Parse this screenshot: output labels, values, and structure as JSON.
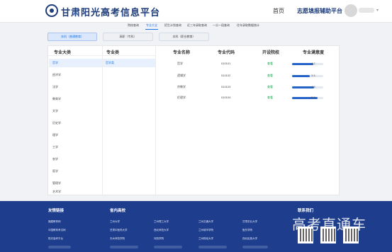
{
  "header": {
    "logo_text": "甘肃阳光高考信息平台",
    "nav_home": "首页",
    "nav_platform": "志愿填报辅助平台"
  },
  "colors": {
    "brand": "#1f3d7a",
    "accent": "#1a73e8",
    "footer_bg": "#1e3d8c",
    "bar": "#2563c9",
    "link_green": "#16a34a"
  },
  "subnav": {
    "items": [
      {
        "label": "院校查询"
      },
      {
        "label": "专业大全"
      },
      {
        "label": "招生计划查询"
      },
      {
        "label": "近三年录取查询"
      },
      {
        "label": "一分一段查询"
      },
      {
        "label": "往年录取数据统计"
      }
    ]
  },
  "levels": {
    "items": [
      {
        "label": "本科（普通教育）"
      },
      {
        "label": "高职（专科）"
      },
      {
        "label": "本科（职业教育）"
      }
    ]
  },
  "table": {
    "headers": {
      "category": "专业大类",
      "subcategory": "专业类",
      "name": "专业名称",
      "code": "专业代码",
      "schools": "开设院校",
      "satisfaction": "专业满意度"
    },
    "categories": [
      {
        "label": "哲学"
      },
      {
        "label": "经济学"
      },
      {
        "label": "法学"
      },
      {
        "label": "教育学"
      },
      {
        "label": "文学"
      },
      {
        "label": "历史学"
      },
      {
        "label": "理学"
      },
      {
        "label": "工学"
      },
      {
        "label": "农学"
      },
      {
        "label": "医学"
      },
      {
        "label": "管理学"
      },
      {
        "label": "艺术学"
      }
    ],
    "subcategory": "哲学类",
    "rows": [
      {
        "name": "哲学",
        "code": "010101",
        "link": "查看",
        "score_label": "4.2",
        "score": 4.2
      },
      {
        "name": "逻辑学",
        "code": "010102",
        "link": "查看",
        "score_label": "3.5",
        "score": 3.5
      },
      {
        "name": "宗教学",
        "code": "010103",
        "link": "查看",
        "score_label": "4.3",
        "score": 4.3
      },
      {
        "name": "伦理学",
        "code": "010104",
        "link": "查看",
        "score_label": "5.0",
        "score": 5.0
      }
    ]
  },
  "footer": {
    "friend_links_head": "友情链接",
    "friend_links": [
      {
        "label": "福建教育网"
      },
      {
        "label": "中国教育考试网"
      },
      {
        "label": "阳光高考平台"
      }
    ],
    "universities_head": "省内高校",
    "universities": [
      {
        "label": "兰州大学"
      },
      {
        "label": "兰州理工大学"
      },
      {
        "label": "兰州交通大学"
      },
      {
        "label": "甘肃农业大学"
      },
      {
        "label": "甘肃中医药大学"
      },
      {
        "label": "西北师范大学"
      },
      {
        "label": "兰州城市学院"
      },
      {
        "label": "陇东学院"
      },
      {
        "label": "天水师范学院"
      },
      {
        "label": "河西学院"
      },
      {
        "label": "兰州财经大学"
      },
      {
        "label": "西北民族大学"
      }
    ],
    "contact_head": "联系我们",
    "watermark": "高考直通车"
  }
}
